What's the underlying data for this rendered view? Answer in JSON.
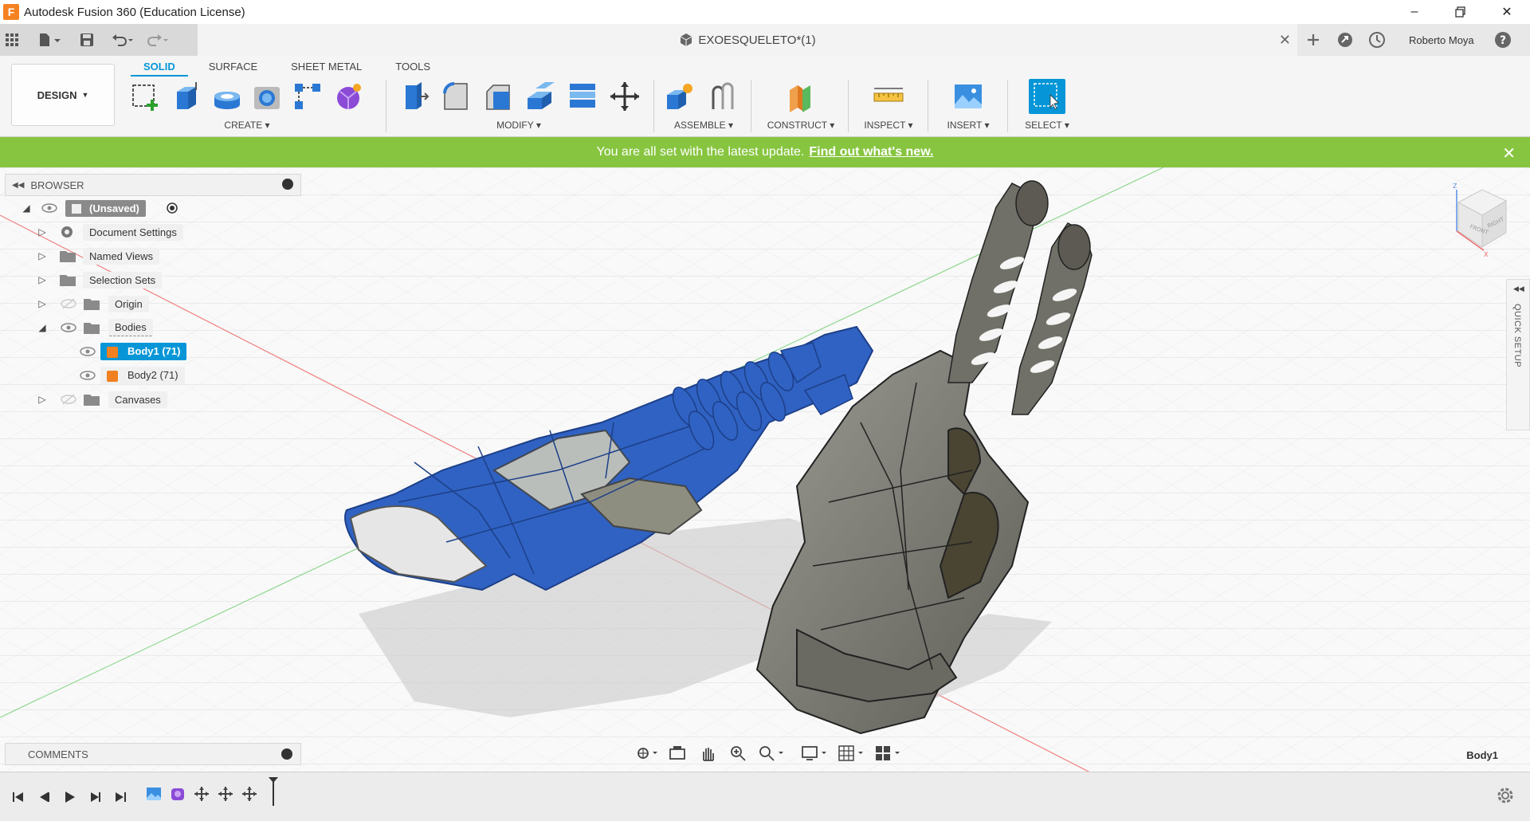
{
  "window": {
    "title": "Autodesk Fusion 360 (Education License)",
    "logo_letter": "F"
  },
  "document": {
    "tab_title": "EXOESQUELETO*(1)"
  },
  "user": {
    "name": "Roberto Moya"
  },
  "workspace": {
    "label": "DESIGN"
  },
  "ribbon": {
    "tabs": [
      {
        "label": "SOLID",
        "active": true
      },
      {
        "label": "SURFACE",
        "active": false
      },
      {
        "label": "SHEET METAL",
        "active": false
      },
      {
        "label": "TOOLS",
        "active": false
      }
    ],
    "groups": {
      "create": "CREATE",
      "modify": "MODIFY",
      "assemble": "ASSEMBLE",
      "construct": "CONSTRUCT",
      "inspect": "INSPECT",
      "insert": "INSERT",
      "select": "SELECT"
    }
  },
  "banner": {
    "text": "You are all set with the latest update.",
    "link": "Find out what's new."
  },
  "browser": {
    "title": "BROWSER",
    "root": "(Unsaved)",
    "items": [
      {
        "label": "Document Settings"
      },
      {
        "label": "Named Views"
      },
      {
        "label": "Selection Sets"
      },
      {
        "label": "Origin"
      },
      {
        "label": "Bodies"
      },
      {
        "label": "Body1 (71)"
      },
      {
        "label": "Body2 (71)"
      },
      {
        "label": "Canvases"
      }
    ]
  },
  "comments": {
    "title": "COMMENTS"
  },
  "quick_setup": {
    "label": "QUICK SETUP"
  },
  "viewcube": {
    "front": "FRONT",
    "right": "RIGHT",
    "axis_z": "Z",
    "axis_x": "X"
  },
  "status": {
    "selected_body": "Body1"
  },
  "colors": {
    "accent": "#0696d7",
    "banner": "#87c540",
    "body1": "#2f62c2",
    "body2": "#7a7a72"
  }
}
